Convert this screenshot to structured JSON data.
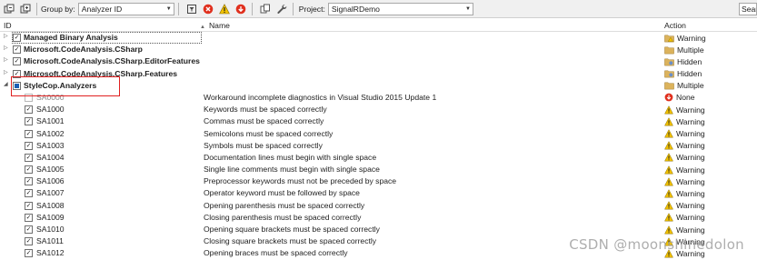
{
  "toolbar": {
    "group_by_label": "Group by:",
    "group_by_value": "Analyzer ID",
    "project_label": "Project:",
    "project_value": "SignalRDemo",
    "search_placeholder": "Search"
  },
  "columns": {
    "id": "ID",
    "name": "Name",
    "action": "Action"
  },
  "groups": [
    {
      "label": "Managed Binary Analysis",
      "action": "Warning",
      "action_icon": "folder-warning-icon",
      "expanded": false
    },
    {
      "label": "Microsoft.CodeAnalysis.CSharp",
      "action": "Multiple",
      "action_icon": "folder-multiple-icon",
      "expanded": false
    },
    {
      "label": "Microsoft.CodeAnalysis.CSharp.EditorFeatures",
      "action": "Hidden",
      "action_icon": "folder-hidden-icon",
      "expanded": false
    },
    {
      "label": "Microsoft.CodeAnalysis.CSharp.Features",
      "action": "Hidden",
      "action_icon": "folder-hidden-icon",
      "expanded": false
    },
    {
      "label": "StyleCop.Analyzers",
      "action": "Multiple",
      "action_icon": "folder-multiple-icon",
      "expanded": true
    }
  ],
  "rules": [
    {
      "id": "SA0000",
      "name": "Workaround incomplete diagnostics in Visual Studio 2015 Update 1",
      "action": "None",
      "checked": false
    },
    {
      "id": "SA1000",
      "name": "Keywords must be spaced correctly",
      "action": "Warning",
      "checked": true
    },
    {
      "id": "SA1001",
      "name": "Commas must be spaced correctly",
      "action": "Warning",
      "checked": true
    },
    {
      "id": "SA1002",
      "name": "Semicolons must be spaced correctly",
      "action": "Warning",
      "checked": true
    },
    {
      "id": "SA1003",
      "name": "Symbols must be spaced correctly",
      "action": "Warning",
      "checked": true
    },
    {
      "id": "SA1004",
      "name": "Documentation lines must begin with single space",
      "action": "Warning",
      "checked": true
    },
    {
      "id": "SA1005",
      "name": "Single line comments must begin with single space",
      "action": "Warning",
      "checked": true
    },
    {
      "id": "SA1006",
      "name": "Preprocessor keywords must not be preceded by space",
      "action": "Warning",
      "checked": true
    },
    {
      "id": "SA1007",
      "name": "Operator keyword must be followed by space",
      "action": "Warning",
      "checked": true
    },
    {
      "id": "SA1008",
      "name": "Opening parenthesis must be spaced correctly",
      "action": "Warning",
      "checked": true
    },
    {
      "id": "SA1009",
      "name": "Closing parenthesis must be spaced correctly",
      "action": "Warning",
      "checked": true
    },
    {
      "id": "SA1010",
      "name": "Opening square brackets must be spaced correctly",
      "action": "Warning",
      "checked": true
    },
    {
      "id": "SA1011",
      "name": "Closing square brackets must be spaced correctly",
      "action": "Warning",
      "checked": true
    },
    {
      "id": "SA1012",
      "name": "Opening braces must be spaced correctly",
      "action": "Warning",
      "checked": true
    }
  ],
  "watermark": "CSDN @moonshinedolon",
  "colors": {
    "error": "#e0301e",
    "warning": "#f2c200",
    "folder": "#dcb35c",
    "highlight_box": "#e02020"
  }
}
